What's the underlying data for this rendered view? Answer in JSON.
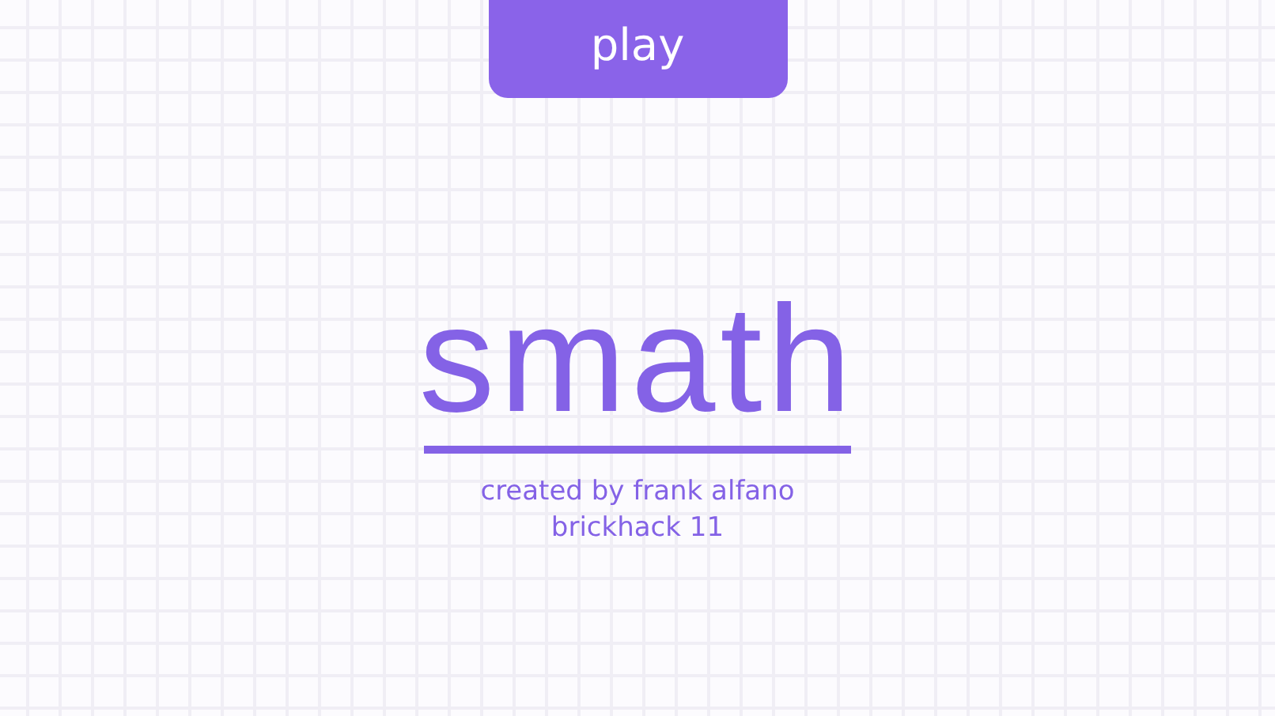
{
  "play_button": {
    "label": "play"
  },
  "title": "smath",
  "credits": [
    "created by frank alfano",
    "brickhack 11"
  ]
}
